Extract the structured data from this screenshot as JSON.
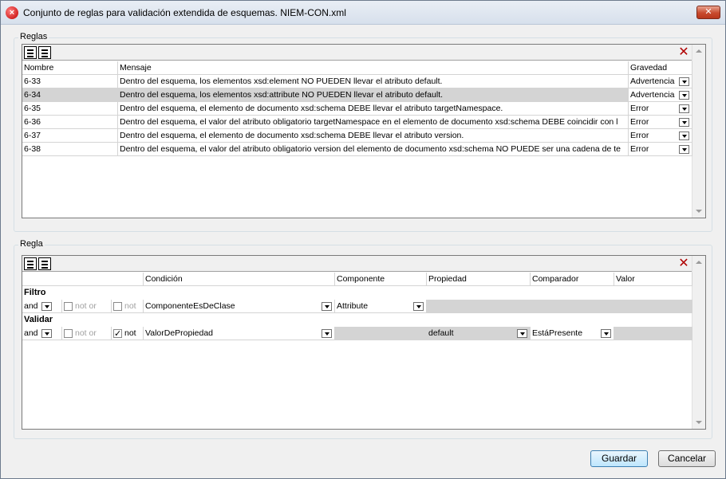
{
  "window": {
    "title": "Conjunto de reglas para validación extendida de esquemas. NIEM-CON.xml"
  },
  "rules_group": {
    "label": "Reglas",
    "headers": {
      "name": "Nombre",
      "message": "Mensaje",
      "severity": "Gravedad"
    },
    "rows": [
      {
        "name": "6-33",
        "message": "Dentro del esquema, los elementos xsd:element NO PUEDEN llevar el atributo default.",
        "severity": "Advertencia"
      },
      {
        "name": "6-34",
        "message": "Dentro del esquema, los elementos xsd:attribute NO PUEDEN llevar el atributo default.",
        "severity": "Advertencia"
      },
      {
        "name": "6-35",
        "message": "Dentro del esquema, el elemento de documento xsd:schema DEBE llevar el atributo targetNamespace.",
        "severity": "Error"
      },
      {
        "name": "6-36",
        "message": "Dentro del esquema, el valor del atributo obligatorio targetNamespace en el elemento de documento xsd:schema DEBE coincidir con l",
        "severity": "Error"
      },
      {
        "name": "6-37",
        "message": "Dentro del esquema, el elemento de documento xsd:schema DEBE llevar el atributo version.",
        "severity": "Error"
      },
      {
        "name": "6-38",
        "message": "Dentro del esquema, el valor del atributo obligatorio version del elemento de documento xsd:schema NO PUEDE ser una cadena de te",
        "severity": "Error"
      }
    ]
  },
  "rule_group": {
    "label": "Regla",
    "headers": {
      "condition": "Condición",
      "component": "Componente",
      "property": "Propiedad",
      "comparator": "Comparador",
      "value": "Valor"
    },
    "filter": {
      "label": "Filtro",
      "logic": "and",
      "not_or": "not or",
      "not_label": "not",
      "condition": "ComponenteEsDeClase",
      "component": "Attribute"
    },
    "validate": {
      "label": "Validar",
      "logic": "and",
      "not_or": "not or",
      "not_label": "not",
      "condition": "ValorDePropiedad",
      "property": "default",
      "comparator": "EstáPresente"
    }
  },
  "buttons": {
    "save": "Guardar",
    "cancel": "Cancelar"
  }
}
